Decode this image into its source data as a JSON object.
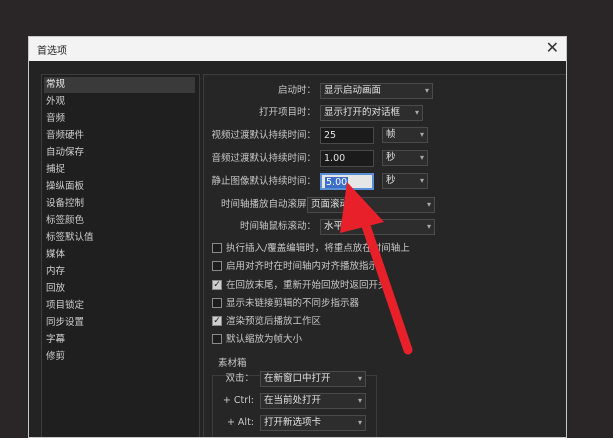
{
  "window": {
    "title": "首选项"
  },
  "sidebar": {
    "items": [
      {
        "label": "常规"
      },
      {
        "label": "外观"
      },
      {
        "label": "音频"
      },
      {
        "label": "音频硬件"
      },
      {
        "label": "自动保存"
      },
      {
        "label": "捕捉"
      },
      {
        "label": "操纵面板"
      },
      {
        "label": "设备控制"
      },
      {
        "label": "标签颜色"
      },
      {
        "label": "标签默认值"
      },
      {
        "label": "媒体"
      },
      {
        "label": "内存"
      },
      {
        "label": "回放"
      },
      {
        "label": "项目锁定"
      },
      {
        "label": "同步设置"
      },
      {
        "label": "字幕"
      },
      {
        "label": "修剪"
      }
    ],
    "selected_index": 0
  },
  "general": {
    "startup": {
      "label": "启动时：",
      "value": "显示启动画面"
    },
    "open_project": {
      "label": "打开项目时：",
      "value": "显示打开的对话框"
    },
    "video_transition": {
      "label": "视频过渡默认持续时间：",
      "value": "25",
      "unit": "帧"
    },
    "audio_transition": {
      "label": "音频过渡默认持续时间：",
      "value": "1.00",
      "unit": "秒"
    },
    "still_image": {
      "label": "静止图像默认持续时间：",
      "value": "5.00",
      "unit": "秒"
    },
    "timeline_autoscroll": {
      "label": "时间轴播放自动滚屏：",
      "value": "页面滚动"
    },
    "timeline_mousescroll": {
      "label": "时间轴鼠标滚动：",
      "value": "水平"
    }
  },
  "checkboxes": [
    {
      "label": "执行插入/覆盖编辑时，将重点放在时间轴上",
      "checked": false
    },
    {
      "label": "启用对齐时在时间轴内对齐播放指示",
      "checked": false
    },
    {
      "label": "在回放末尾，重新开始回放时返回开头",
      "checked": true
    },
    {
      "label": "显示未链接剪辑的不同步指示器",
      "checked": false
    },
    {
      "label": "渲染预览后播放工作区",
      "checked": true
    },
    {
      "label": "默认缩放为帧大小",
      "checked": false
    }
  ],
  "bins": {
    "title": "素材箱",
    "double_click": {
      "label": "双击：",
      "value": "在新窗口中打开"
    },
    "ctrl": {
      "label": "+ Ctrl:",
      "value": "在当前处打开"
    },
    "alt": {
      "label": "+ Alt:",
      "value": "打开新选项卡"
    }
  },
  "colors": {
    "annotation_arrow": "#e8202a",
    "focus_blue": "#3b6fc9"
  }
}
